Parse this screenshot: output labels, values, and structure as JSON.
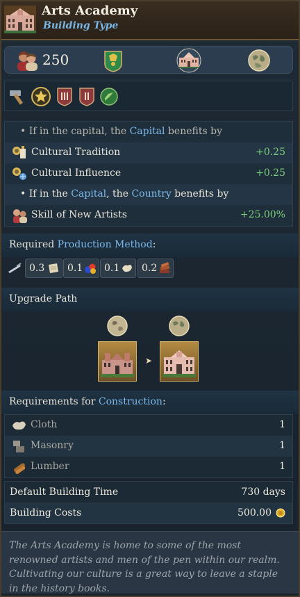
{
  "header": {
    "title": "Arts Academy",
    "subtitle": "Building Type",
    "icon": "building-icon"
  },
  "stats": {
    "population": "250",
    "icons": [
      "population-icon",
      "shield-icon",
      "building-icon",
      "globe-icon"
    ]
  },
  "icon_row": {
    "icons": [
      "hammer-icon",
      "star-icon",
      "rank-iii-icon",
      "rank-ii-icon",
      "green-check-icon"
    ]
  },
  "benefits": {
    "rows": [
      {
        "pre": "• If in the capital, the ",
        "hl": "Capital",
        "post": " benefits by"
      },
      {
        "label": "Cultural Tradition",
        "value": "+0.25",
        "icon": "cultural-tradition-icon"
      },
      {
        "label": "Cultural Influence",
        "value": "+0.25",
        "icon": "cultural-influence-icon"
      },
      {
        "pre": "• If in the ",
        "hl": "Capital",
        "mid": ", the ",
        "hl2": "Country",
        "post": " benefits by"
      },
      {
        "label": "Skill of New Artists",
        "value": "+25.00%",
        "icon": "artists-icon"
      }
    ]
  },
  "production": {
    "title_pre": "Required ",
    "title_hl": "Production Method",
    "title_post": ":",
    "items": [
      {
        "value": "0.3",
        "icon": "paper-icon"
      },
      {
        "value": "0.1",
        "icon": "dyes-icon"
      },
      {
        "value": "0.1",
        "icon": "cloth-icon"
      },
      {
        "value": "0.2",
        "icon": "books-icon"
      }
    ]
  },
  "upgrade": {
    "title": "Upgrade Path"
  },
  "requirements": {
    "title_pre": "Requirements for ",
    "title_hl": "Construction",
    "title_post": ":",
    "items": [
      {
        "name": "Cloth",
        "value": "1",
        "icon": "cloth-icon"
      },
      {
        "name": "Masonry",
        "value": "1",
        "icon": "masonry-icon"
      },
      {
        "name": "Lumber",
        "value": "1",
        "icon": "lumber-icon"
      }
    ]
  },
  "costs": {
    "build_time_label": "Default Building Time",
    "build_time_value": "730 days",
    "cost_label": "Building Costs",
    "cost_value": "500.00"
  },
  "description": "The Arts Academy is home to some of the most renowned artists and men of the pen within our realm. Cultivating our culture is a great way to leave a staple in the history books.",
  "colors": {
    "highlight": "#7cb8e8",
    "positive": "#7ad07a",
    "header_bg": "#3a2d20"
  }
}
